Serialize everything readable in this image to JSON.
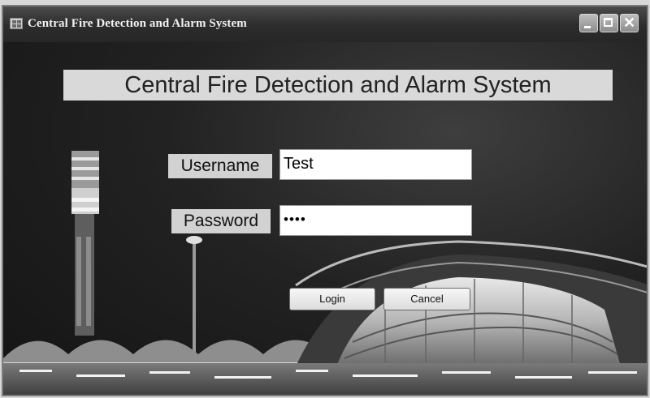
{
  "window": {
    "title": "Central Fire Detection and Alarm System",
    "controls": {
      "minimize": "minimize",
      "maximize": "maximize",
      "close": "✕"
    }
  },
  "form": {
    "heading": "Central Fire Detection and Alarm System",
    "username_label": "Username",
    "username_value": "Test",
    "password_label": "Password",
    "password_value": "••••",
    "login_label": "Login",
    "cancel_label": "Cancel"
  },
  "colors": {
    "titlebar": "#2c2c2c",
    "background": "#1a1a1a",
    "label_bg": "#d2d2d2",
    "heading_bg": "#d9d9d9"
  }
}
